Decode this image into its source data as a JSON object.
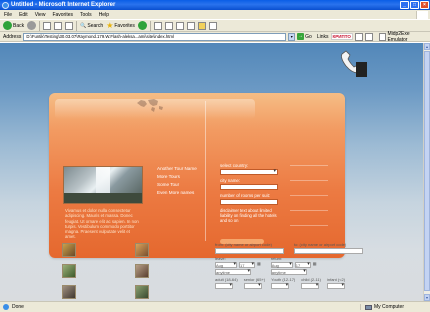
{
  "window": {
    "title": "Untitled - Microsoft Internet Explorer",
    "buttons": [
      "_",
      "□",
      "×"
    ]
  },
  "menu": {
    "items": [
      "File",
      "Edit",
      "View",
      "Favorites",
      "Tools",
      "Help"
    ]
  },
  "toolbar": {
    "back_label": "Back",
    "search_label": "Search",
    "favorites_label": "Favorites"
  },
  "address": {
    "label": "Address",
    "value": "D:\\Funtik\\Testing\\30.03.07\\Raymond.179.W.Flash-aleksa...ami\\site\\index.html",
    "go_label": "Go",
    "links_label": "Links",
    "ext_logo_text": "КРИПТО",
    "emulator_label": "Midp2Exe Emulator"
  },
  "card": {
    "blurb": "Vivamus et dolor nulla consectetur adipiscing. Mauris et massa. Donec feugiat. Ut ornare elit ac sapien. In non turpis. Vestibulum commodo porttitor magna. Praesent vulputate velit et amet.",
    "links": [
      "Another Tour Name",
      "More Tours",
      "Some Tour",
      "Even More names"
    ],
    "form": {
      "country_label": "select country:",
      "city_label": "city name:",
      "rooms_label": "number of rooms per suit:",
      "disclaimer": "disclaimer text about limited liability on finding all the hotels and so on"
    }
  },
  "search": {
    "from_label": "from: (city name or airport code)",
    "to_label": "to: (city name or airport code)",
    "depart_label": "leave:",
    "return_label": "return:",
    "month": "Aug",
    "day": "17",
    "time": "anytime",
    "pax_labels": [
      "adult (18-64)",
      "senior (65+)",
      "Youth (12-17)",
      "child (2-11)",
      "infant (<2)"
    ]
  },
  "status": {
    "text": "Done",
    "zone": "My Computer"
  }
}
